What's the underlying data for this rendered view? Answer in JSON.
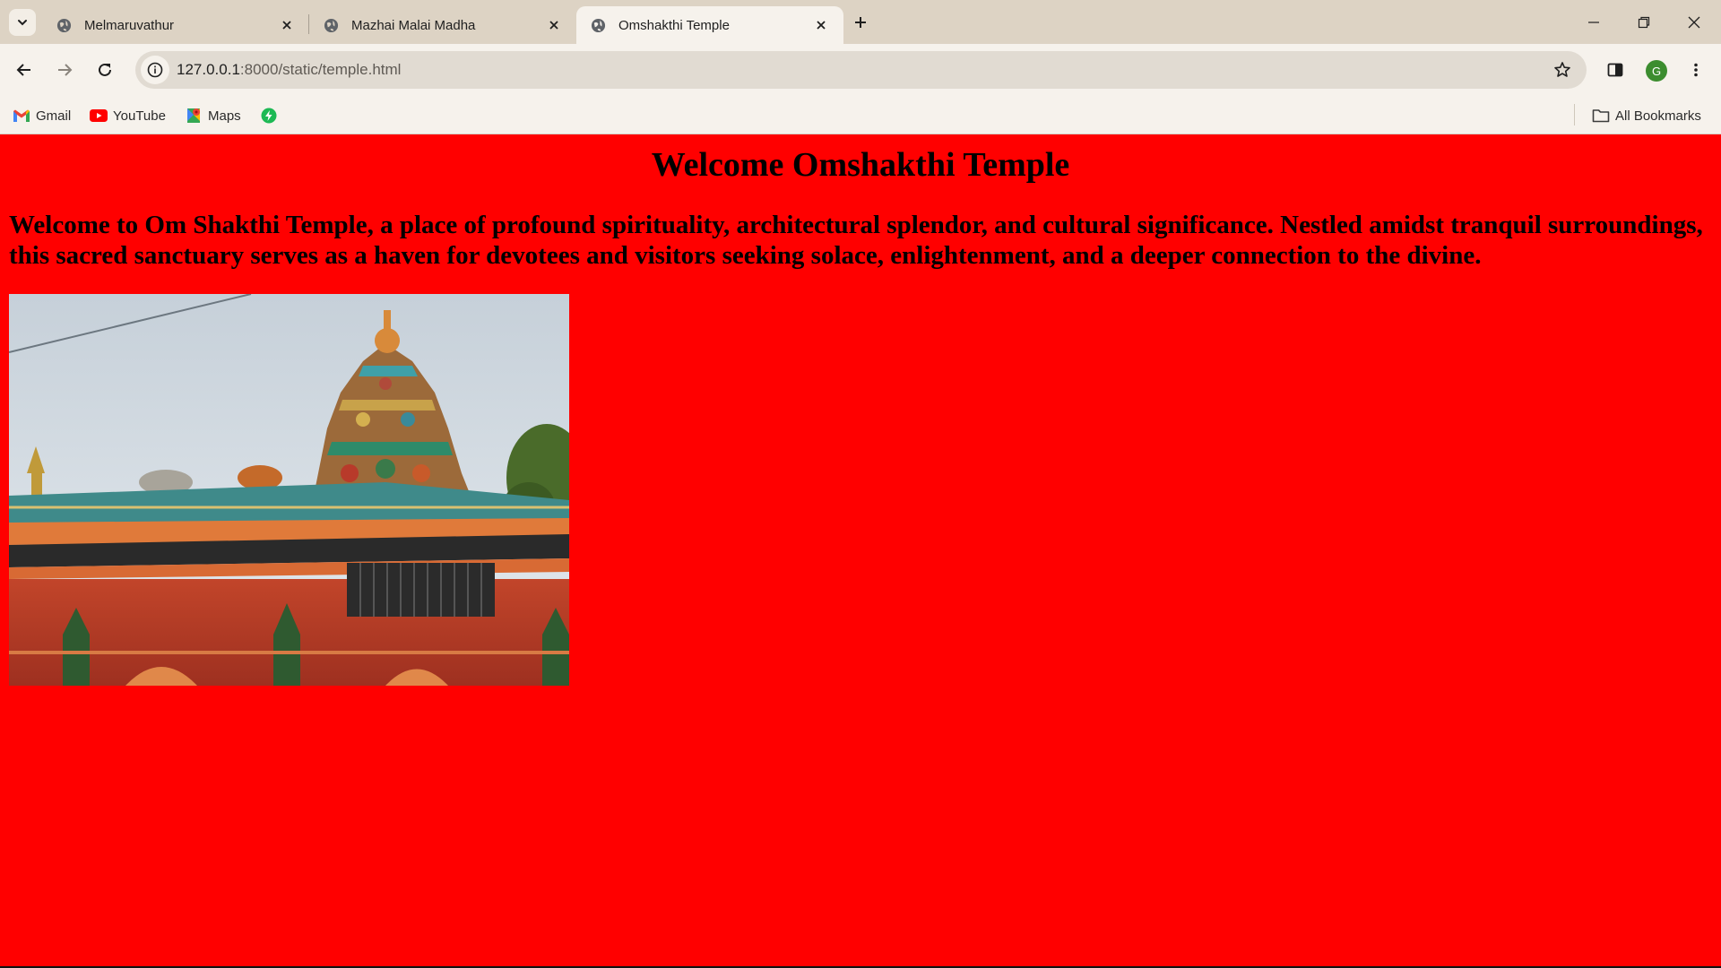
{
  "browser": {
    "tabs": [
      {
        "title": "Melmaruvathur",
        "active": false
      },
      {
        "title": "Mazhai Malai Madha",
        "active": false
      },
      {
        "title": "Omshakthi Temple",
        "active": true
      }
    ],
    "address_bar": {
      "host": "127.0.0.1",
      "path": ":8000/static/temple.html"
    },
    "profile_initial": "G",
    "bookmarks": [
      {
        "label": "Gmail",
        "icon": "gmail-icon"
      },
      {
        "label": "YouTube",
        "icon": "youtube-icon"
      },
      {
        "label": "Maps",
        "icon": "maps-icon"
      },
      {
        "label": "",
        "icon": "green-bolt-icon"
      }
    ],
    "all_bookmarks_label": "All Bookmarks"
  },
  "page": {
    "background_color": "#ff0000",
    "heading": "Welcome Omshakthi Temple",
    "intro": "Welcome to Om Shakthi Temple, a place of profound spirituality, architectural splendor, and cultural significance. Nestled amidst tranquil surroundings, this sacred sanctuary serves as a haven for devotees and visitors seeking solace, enlightenment, and a deeper connection to the divine.",
    "image": {
      "subject": "temple-photo"
    }
  }
}
